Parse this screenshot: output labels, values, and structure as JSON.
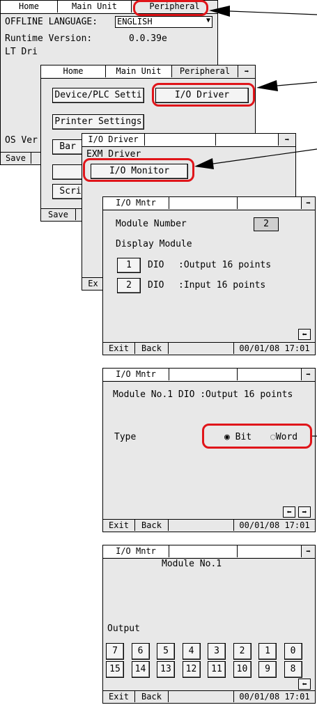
{
  "w1": {
    "tabs": [
      "Home",
      "Main Unit",
      "Peripheral"
    ],
    "lang_label": "OFFLINE LANGUAGE:",
    "lang_value": "ENGLISH",
    "runtime_label": "Runtime Version:",
    "runtime_value": "0.0.39e",
    "lt_driver": "LT Dri",
    "os_version": "OS Ver",
    "save": "Save"
  },
  "w2": {
    "tabs": [
      "Home",
      "Main Unit",
      "Peripheral"
    ],
    "device_btn": "Device/PLC Setti",
    "io_driver_btn": "I/O Driver",
    "printer_btn": "Printer Settings",
    "barcode_btn": "Bar C",
    "script_btn": "Scrip",
    "save": "Save"
  },
  "w3": {
    "title": "I/O Driver",
    "exm": "EXM Driver",
    "io_monitor_btn": "I/O Monitor",
    "exit_partial": "Ex"
  },
  "w4": {
    "title": "I/O Mntr",
    "module_number_label": "Module Number",
    "module_number_value": "2",
    "display_module": "Display Module",
    "rows": [
      {
        "num": "1",
        "type": "DIO",
        "desc": ":Output 16 points"
      },
      {
        "num": "2",
        "type": "DIO",
        "desc": ":Input 16 points"
      }
    ],
    "exit": "Exit",
    "back": "Back",
    "datetime": "00/01/08 17:01"
  },
  "w5": {
    "title": "I/O Mntr",
    "module_info": "Module No.1  DIO   :Output 16 points",
    "type_label": "Type",
    "bit": "Bit",
    "word": "Word",
    "selected": "Bit",
    "exit": "Exit",
    "back": "Back",
    "datetime": "00/01/08 17:01"
  },
  "w6": {
    "title": "I/O Mntr",
    "module": "Module No.1",
    "output": "Output",
    "row1": [
      "7",
      "6",
      "5",
      "4",
      "3",
      "2",
      "1",
      "0"
    ],
    "row2": [
      "15",
      "14",
      "13",
      "12",
      "11",
      "10",
      "9",
      "8"
    ],
    "exit": "Exit",
    "back": "Back",
    "datetime": "00/01/08 17:01"
  },
  "colors": {
    "highlight": "#e0151a",
    "panel": "#e8e8e8"
  },
  "icons": [
    "dropdown-arrow-icon",
    "right-arrow-icon",
    "left-arrow-icon",
    "pointer-arrow-icon"
  ]
}
